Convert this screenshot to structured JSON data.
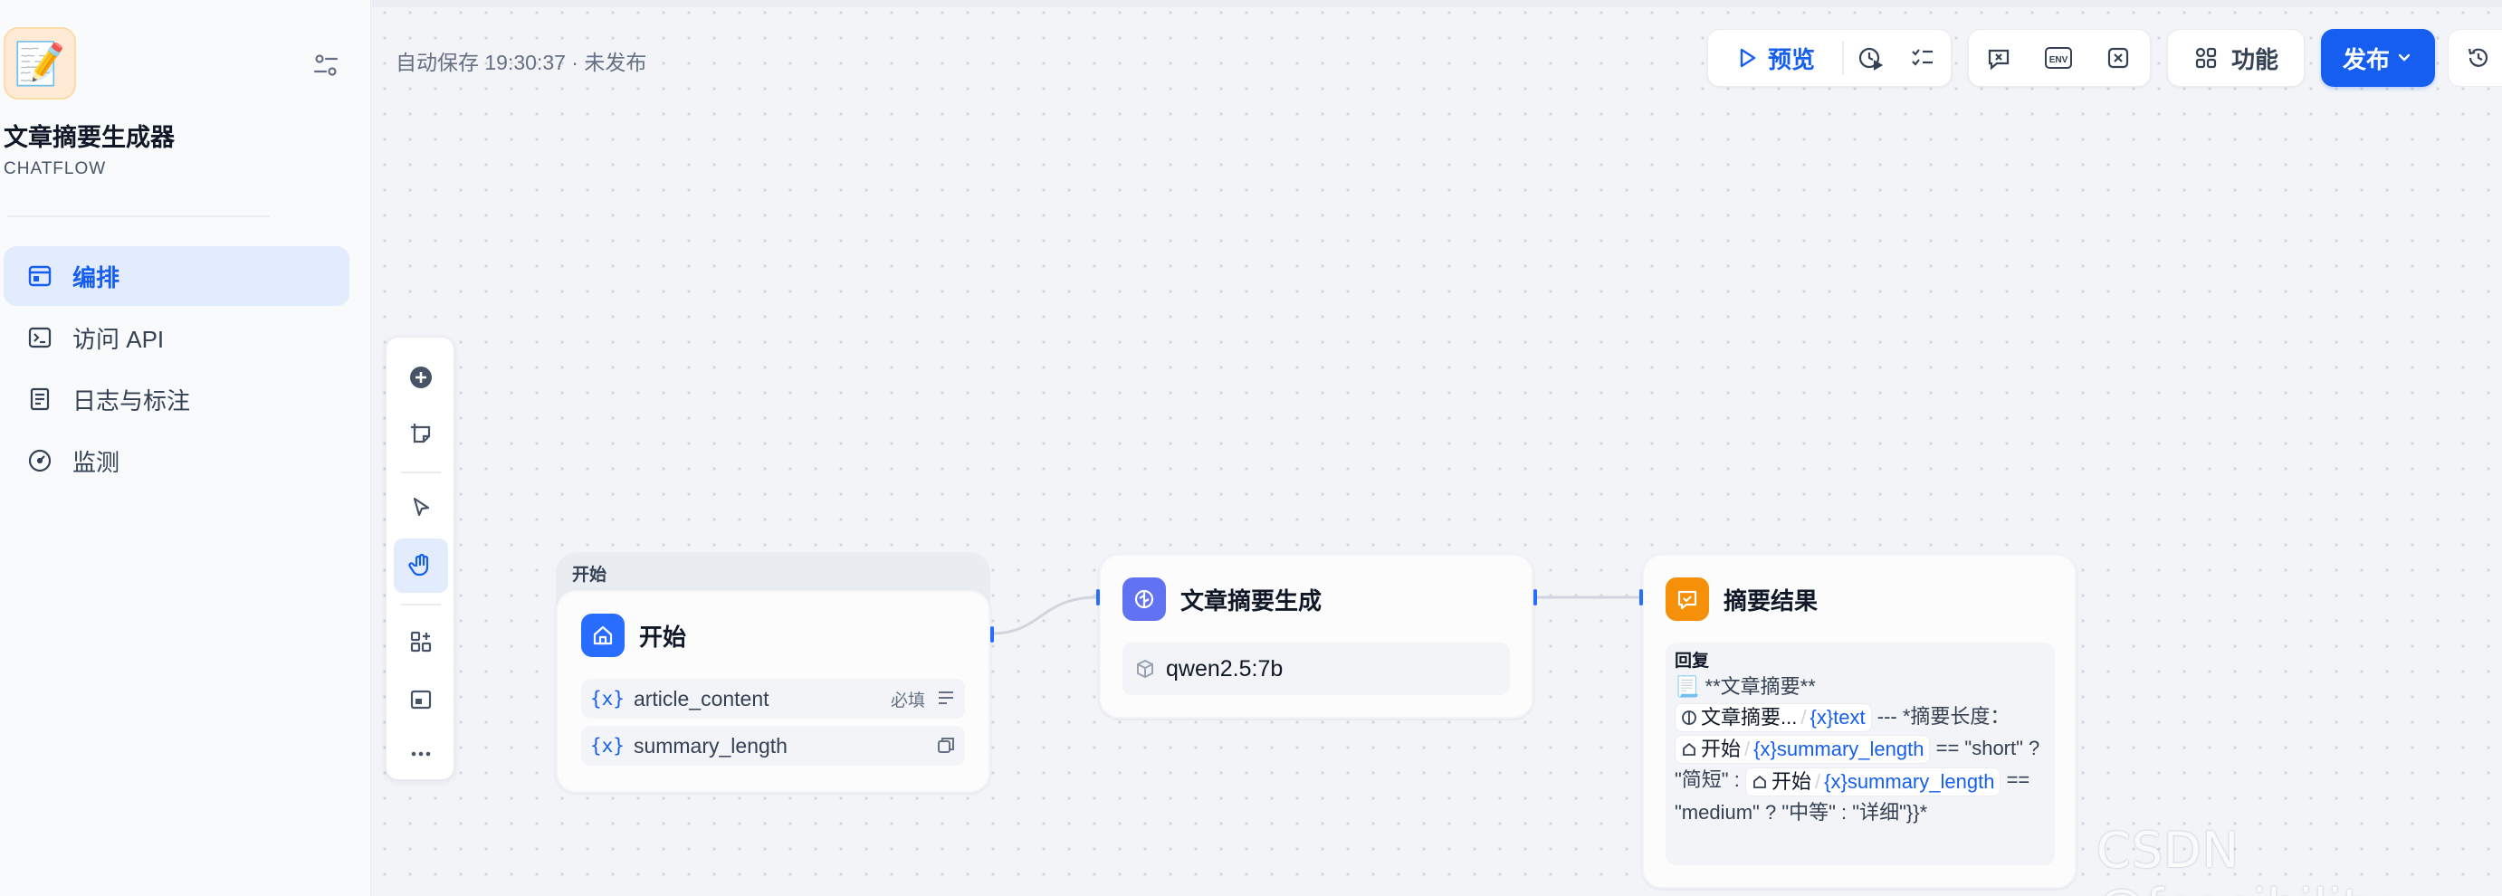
{
  "app": {
    "icon": "📝",
    "name": "文章摘要生成器",
    "mode": "CHATFLOW"
  },
  "nav": {
    "items": [
      {
        "label": "编排",
        "icon": "layout-icon",
        "active": true
      },
      {
        "label": "访问 API",
        "icon": "terminal-icon",
        "active": false
      },
      {
        "label": "日志与标注",
        "icon": "document-icon",
        "active": false
      },
      {
        "label": "监测",
        "icon": "gauge-icon",
        "active": false
      }
    ]
  },
  "canvas": {
    "autosave": "自动保存 19:30:37 · 未发布"
  },
  "toolbar": {
    "preview_label": "预览",
    "feature_label": "功能",
    "publish_label": "发布"
  },
  "nodes": {
    "start": {
      "group_label": "开始",
      "title": "开始",
      "vars": [
        {
          "name": "article_content",
          "required_label": "必填"
        },
        {
          "name": "summary_length"
        }
      ]
    },
    "llm": {
      "title": "文章摘要生成",
      "model": "qwen2.5:7b"
    },
    "answer": {
      "title": "摘要结果",
      "reply_label": "回复",
      "line1": "📃 **文章摘要**",
      "chip1_node": "文章摘要...",
      "chip1_var": "text",
      "text_after_chip1": " --- *摘要长度：",
      "chip2_node": "开始",
      "chip2_var": "summary_length",
      "text_after_chip2": " == \"short\" ? \"简短\" : ",
      "chip3_node": "开始",
      "chip3_var": "summary_length",
      "text_after_chip3": " == \"medium\" ? \"中等\" : \"详细\"}}*"
    }
  },
  "watermark": "CSDN @feasibility."
}
